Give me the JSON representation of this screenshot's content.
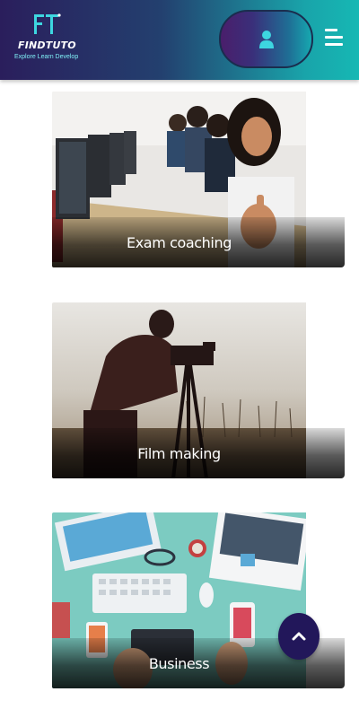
{
  "header": {
    "logo_name": "FINDTUTO",
    "logo_tagline": "Explore Learn Develop",
    "icons": {
      "user": "user-icon",
      "menu": "hamburger-menu-icon"
    }
  },
  "courses": [
    {
      "label": "Exam coaching"
    },
    {
      "label": "Film making"
    },
    {
      "label": "Business"
    }
  ],
  "back_to_top": {
    "icon": "chevron-up-icon"
  },
  "colors": {
    "header_start": "#2a1e5c",
    "header_end": "#16b8b4",
    "accent_cyan": "#3dd6e0",
    "scroll_button": "#22175a"
  }
}
